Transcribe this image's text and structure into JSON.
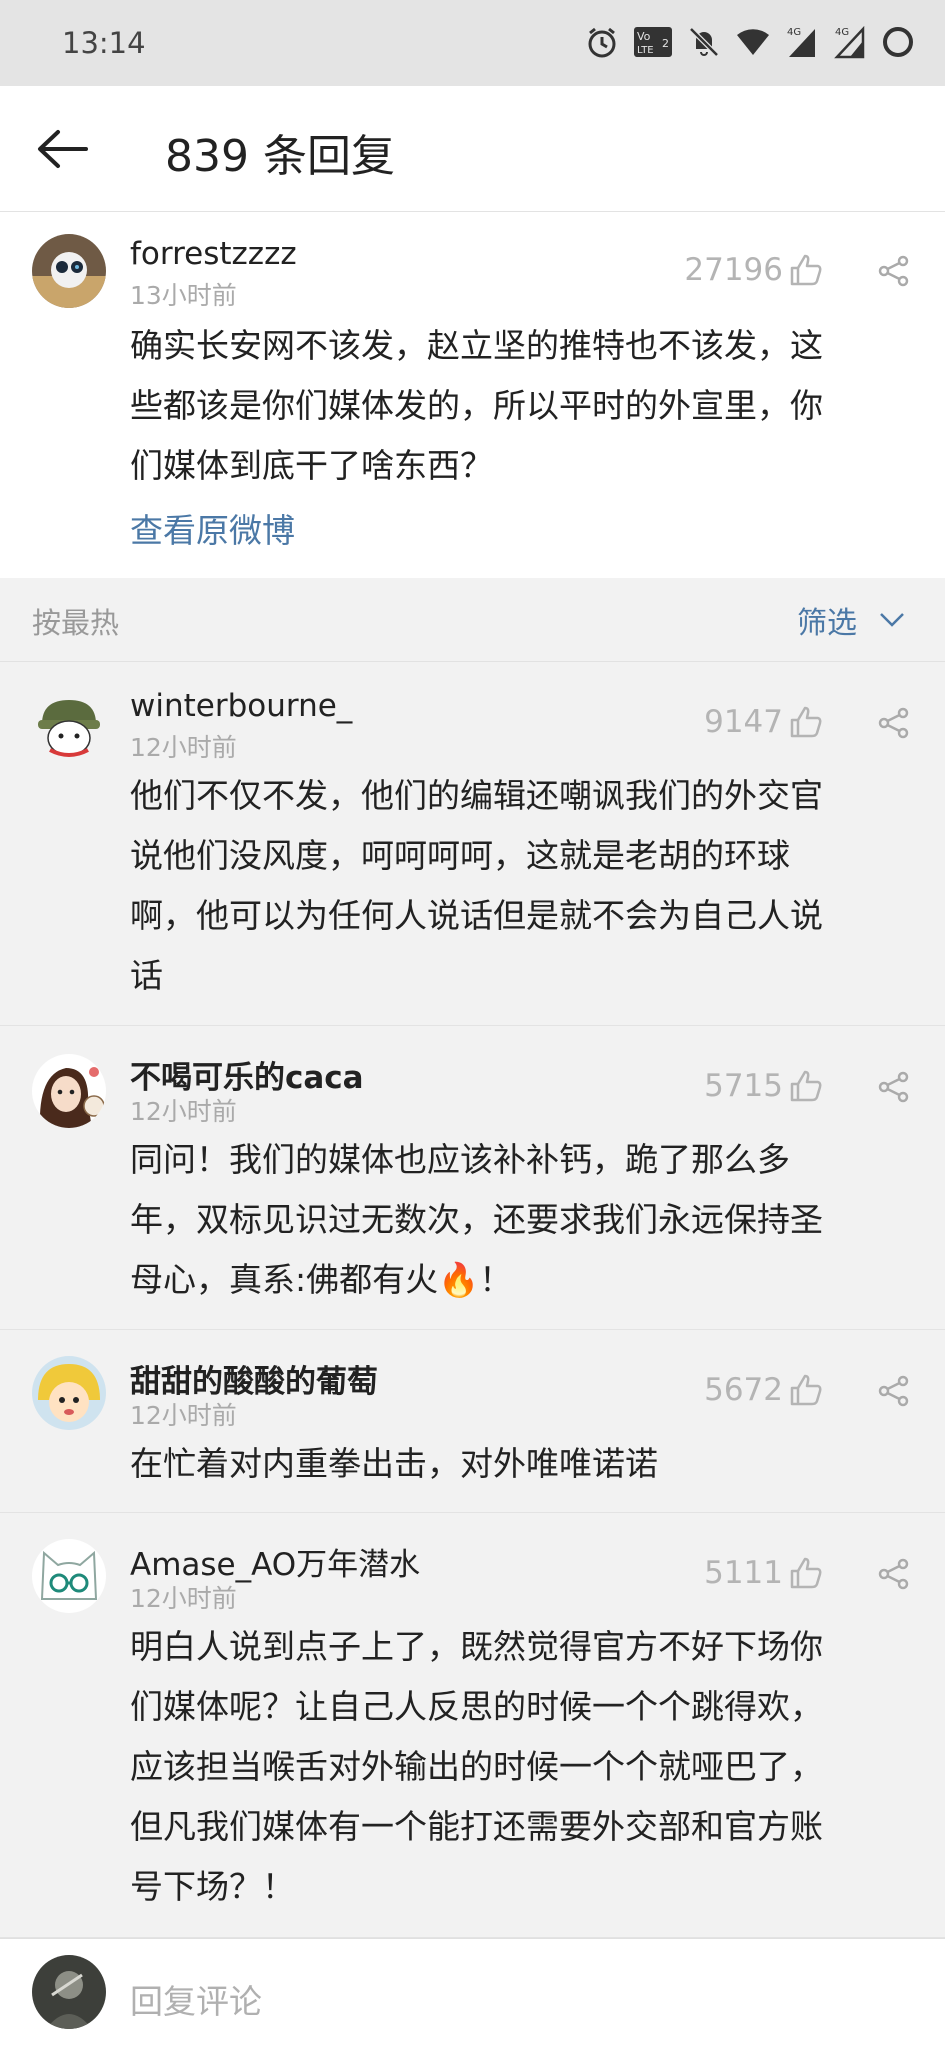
{
  "status_bar": {
    "time": "13:14",
    "icons": [
      "alarm-icon",
      "volte-icon",
      "mute-icon",
      "wifi-icon",
      "signal-4g-icon",
      "signal-4g-icon",
      "battery-icon"
    ],
    "network_labels": [
      "4G",
      "4G"
    ]
  },
  "header": {
    "title": "839 条回复",
    "back_icon": "back-arrow-icon"
  },
  "original_post": {
    "username": "forrestzzzz",
    "time": "13小时前",
    "likes": "27196",
    "text_lines": [
      "确实长安网不该发，赵立坚的推特也不该发，这",
      "些都该是你们媒体发的，所以平时的外宣里，你",
      "们媒体到底干了啥东西？"
    ],
    "view_original": "查看原微博"
  },
  "sort_bar": {
    "label": "按最热",
    "filter": "筛选"
  },
  "comments": [
    {
      "username": "winterbourne_",
      "time": "12小时前",
      "likes": "9147",
      "text_lines": [
        "他们不仅不发，他们的编辑还嘲讽我们的外交官",
        "说他们没风度，呵呵呵呵，这就是老胡的环球",
        "啊，他可以为任何人说话但是就不会为自己人说",
        "话"
      ]
    },
    {
      "username": "不喝可乐的caca",
      "time": "12小时前",
      "likes": "5715",
      "text_lines": [
        "同问！我们的媒体也应该补补钙，跪了那么多",
        "年，双标见识过无数次，还要求我们永远保持圣",
        "母心，真系:佛都有火🔥！"
      ]
    },
    {
      "username": "甜甜的酸酸的葡萄",
      "time": "12小时前",
      "likes": "5672",
      "text_lines": [
        "在忙着对内重拳出击，对外唯唯诺诺"
      ]
    },
    {
      "username": "Amase_AO万年潜水",
      "time": "12小时前",
      "likes": "5111",
      "text_lines": [
        "明白人说到点子上了，既然觉得官方不好下场你",
        "们媒体呢？让自己人反思的时候一个个跳得欢，",
        "应该担当喉舌对外输出的时候一个个就哑巴了，",
        "但凡我们媒体有一个能打还需要外交部和官方账",
        "号下场？！"
      ]
    }
  ],
  "reply_bar": {
    "placeholder": "回复评论"
  },
  "colors": {
    "link": "#4b78a6",
    "muted": "#aaaaaa",
    "background": "#f2f2f2"
  }
}
